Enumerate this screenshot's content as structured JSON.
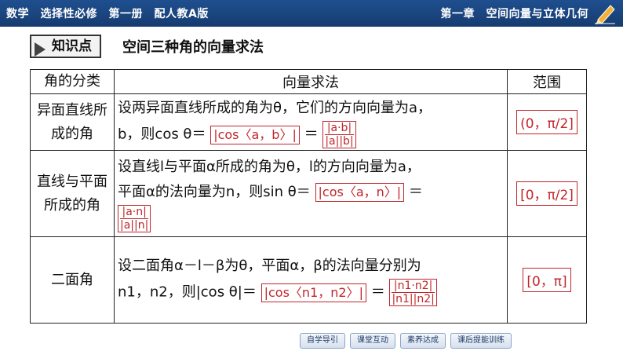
{
  "header": {
    "left_text": "数学　选择性必修　第一册　配人教A版",
    "right_text": "第一章　空间向量与立体几何",
    "pencil_icon": "pencil-icon"
  },
  "section": {
    "badge": "知识点",
    "title": "空间三种角的向量求法"
  },
  "table": {
    "headers": [
      "角的分类",
      "向量求法",
      "范围"
    ],
    "rows": [
      {
        "category": "异面直线所成的角",
        "line1": "设两异面直线所成的角为θ，它们的方向向量为a，",
        "line2_prefix": "b，则cos θ＝",
        "box1": "|cos〈a，b〉|",
        "equals": "＝",
        "frac_num": "|a·b|",
        "frac_den": "|a||b|",
        "range": "(0，π/2]"
      },
      {
        "category": "直线与平面所成的角",
        "line1": "设直线l与平面α所成的角为θ，l的方向向量为a，",
        "line2_prefix": "平面α的法向量为n，则sin θ＝",
        "box1": "|cos〈a，n〉|",
        "equals": "＝",
        "frac_num": "|a·n|",
        "frac_den": "|a||n|",
        "range": "[0，π/2]"
      },
      {
        "category": "二面角",
        "line1": "设二面角α－l－β为θ，平面α，β的法向量分别为",
        "line2_prefix": "n1，n2，则|cos θ|＝",
        "box1": "|cos〈n1，n2〉|",
        "equals": "＝",
        "frac_num": "|n1·n2|",
        "frac_den": "|n1||n2|",
        "range": "[0，π]"
      }
    ]
  },
  "bottom_nav": [
    "自学导引",
    "课堂互动",
    "素养达成",
    "课后提能训练"
  ]
}
